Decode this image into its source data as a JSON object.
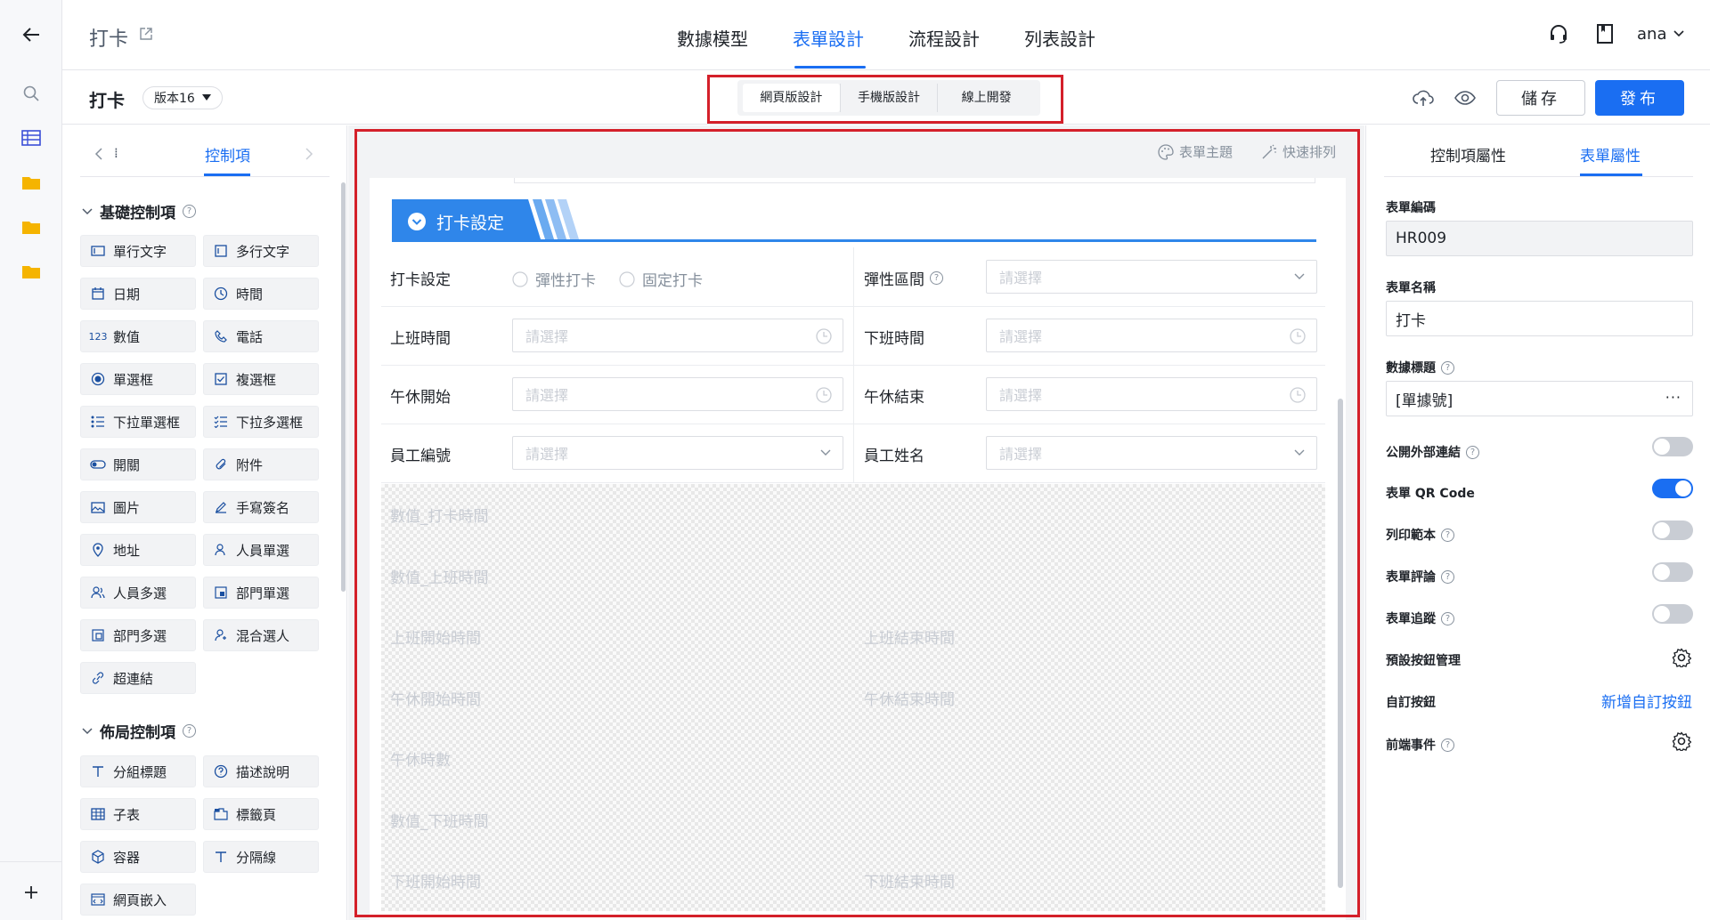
{
  "header": {
    "title": "打卡",
    "nav_tabs": [
      {
        "label": "數據模型",
        "active": false
      },
      {
        "label": "表單設計",
        "active": true
      },
      {
        "label": "流程設計",
        "active": false
      },
      {
        "label": "列表設計",
        "active": false
      }
    ],
    "user": "ana"
  },
  "toolbar": {
    "form_name": "打卡",
    "version": "版本16",
    "modes": [
      "網頁版設計",
      "手機版設計",
      "線上開發"
    ],
    "save_label": "儲存",
    "publish_label": "發布"
  },
  "left_panel": {
    "tab_label": "控制項",
    "basic_section": "基礎控制項",
    "basic_controls": [
      "單行文字",
      "多行文字",
      "日期",
      "時間",
      "數值",
      "電話",
      "單選框",
      "複選框",
      "下拉單選框",
      "下拉多選框",
      "開關",
      "附件",
      "圖片",
      "手寫簽名",
      "地址",
      "人員單選",
      "人員多選",
      "部門單選",
      "部門多選",
      "混合選人",
      "超連結"
    ],
    "layout_section": "佈局控制項",
    "layout_controls": [
      "分組標題",
      "描述說明",
      "子表",
      "標籤頁",
      "容器",
      "分隔線",
      "網頁嵌入"
    ]
  },
  "canvas": {
    "theme_label": "表單主題",
    "arrange_label": "快速排列",
    "group_title": "打卡設定",
    "fields": {
      "punch_setting": "打卡設定",
      "opt_flexible": "彈性打卡",
      "opt_fixed": "固定打卡",
      "flex_range": "彈性區間",
      "work_start": "上班時間",
      "work_end": "下班時間",
      "lunch_start": "午休開始",
      "lunch_end": "午休結束",
      "emp_no": "員工編號",
      "emp_name": "員工姓名",
      "placeholder": "請選擇"
    },
    "hidden_fields": {
      "f1": "數值_打卡時間",
      "f2": "數值_上班時間",
      "f3": "上班開始時間",
      "f4": "上班結束時間",
      "f5": "午休開始時間",
      "f6": "午休結束時間",
      "f7": "午休時數",
      "f8": "數值_下班時間",
      "f9": "下班開始時間",
      "f10": "下班結束時間"
    }
  },
  "right_panel": {
    "tab_control_props": "控制項屬性",
    "tab_form_props": "表單屬性",
    "form_code_label": "表單編碼",
    "form_code": "HR009",
    "form_name_label": "表單名稱",
    "form_name": "打卡",
    "data_title_label": "數據標題",
    "data_title": "[單據號]",
    "public_link": "公開外部連結",
    "qr_code": "表單 QR Code",
    "print_template": "列印範本",
    "form_comment": "表單評論",
    "form_track": "表單追蹤",
    "default_buttons": "預設按鈕管理",
    "custom_buttons": "自訂按鈕",
    "add_custom_button": "新增自訂按鈕",
    "frontend_events": "前端事件",
    "toggles": {
      "public_link": false,
      "qr_code": true,
      "print_template": false,
      "form_comment": false,
      "form_track": false
    }
  },
  "colors": {
    "accent": "#1a6ef2",
    "highlight_box": "#d4202a"
  }
}
